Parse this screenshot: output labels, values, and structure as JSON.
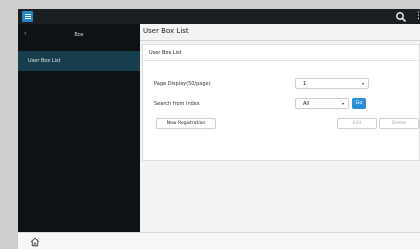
{
  "topbar": {
    "menu_icon": "hamburger-menu-icon",
    "search_icon": "search-icon",
    "more_icon": "more-vertical-icon",
    "more_glyph": "⋮"
  },
  "sidebar": {
    "back_glyph": "‹",
    "title": "Box",
    "items": [
      {
        "label": "User Box List"
      }
    ]
  },
  "main": {
    "title": "User Box List",
    "card": {
      "title": "User Box List",
      "page_display": {
        "label": "Page Display(50/page)",
        "value": "1",
        "arrow": "▾"
      },
      "search_index": {
        "label": "Search from Index",
        "value": "All",
        "arrow": "▾",
        "go_label": "Go"
      },
      "buttons": {
        "new_registration": "New Registration",
        "edit": "Edit",
        "delete": "Delete"
      }
    }
  },
  "footer": {
    "home_icon": "home-icon"
  },
  "colors": {
    "accent": "#2a8fd6",
    "topbar": "#1b1f24",
    "sidebar": "#0f1215",
    "sidebar_selected": "#163e4d"
  }
}
